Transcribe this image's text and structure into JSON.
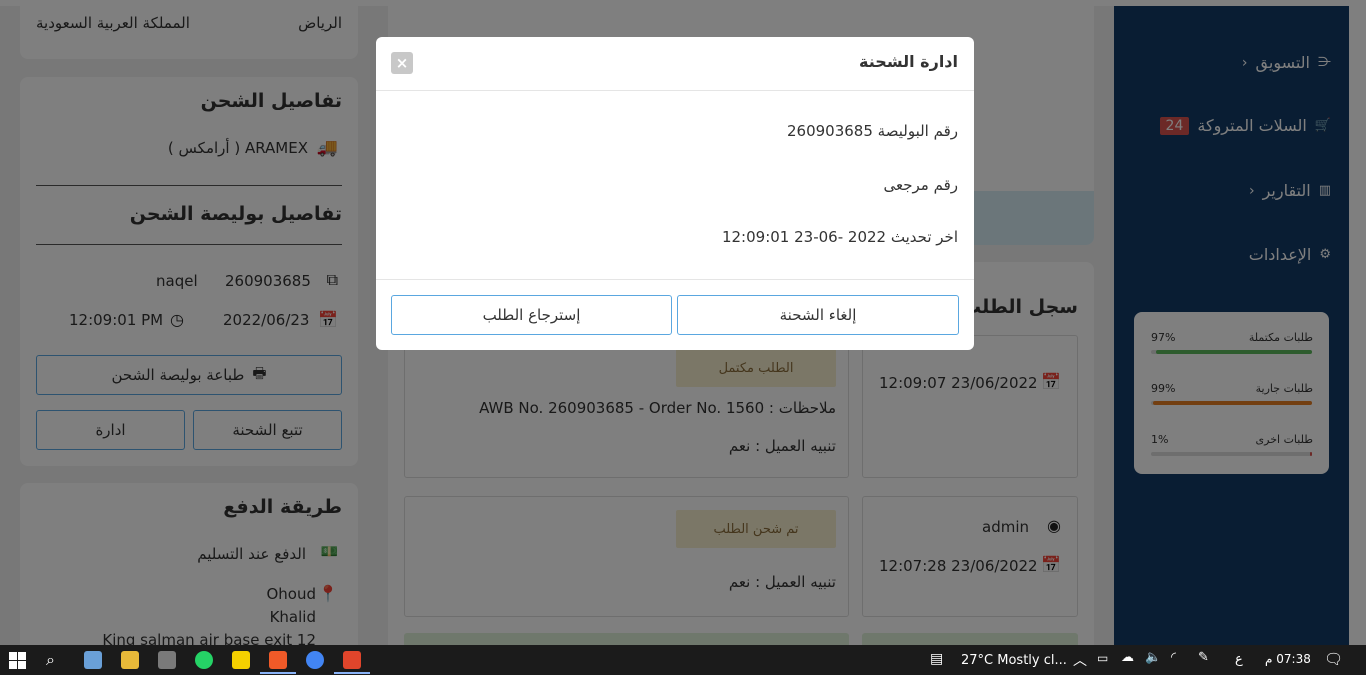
{
  "address": {
    "city": "الرياض",
    "country": "المملكة العربية السعودية"
  },
  "shipping": {
    "title": "تفاصيل الشحن",
    "carrier": "ARAMEX ( أرامكس )",
    "awb_title": "تفاصيل بوليصة الشحن",
    "awb_number": "260903685",
    "awb_company": "naqel",
    "date": "2022/06/23",
    "time": "12:09:01 PM",
    "print_label": "طباعة بوليصة الشحن",
    "track_label": "تتبع الشحنة",
    "manage_label": "ادارة"
  },
  "payment": {
    "title": "طريقة الدفع",
    "method": "الدفع عند التسليم",
    "name_line1": "Ohoud",
    "name_line2": "Khalid",
    "address_line": "King salman air base exit 12"
  },
  "history": {
    "title": "سجل الطلب",
    "entries": [
      {
        "status": "الطلب مكتمل",
        "notes": "ملاحظات : AWB No. 260903685 - Order No. 1560",
        "notify": "تنبيه العميل : نعم",
        "datetime": "12:09:07 23/06/2022"
      },
      {
        "status": "تم شحن الطلب",
        "notify": "تنبيه العميل : نعم",
        "user": "admin",
        "datetime": "12:07:28 23/06/2022"
      }
    ]
  },
  "sidebar": {
    "items": [
      {
        "label": "التسويق",
        "icon": "share-icon"
      },
      {
        "label": "السلات المتروكة",
        "icon": "cart-icon",
        "badge": "24"
      },
      {
        "label": "التقارير",
        "icon": "bar-chart-icon"
      },
      {
        "label": "الإعدادات",
        "icon": "gear-icon"
      }
    ],
    "stats": [
      {
        "label": "طلبات مكتملة",
        "percent": "97%",
        "value": 97,
        "color": "#5cb85c"
      },
      {
        "label": "طلبات جارية",
        "percent": "99%",
        "value": 99,
        "color": "#e67e22"
      },
      {
        "label": "طلبات اخرى",
        "percent": "1%",
        "value": 1,
        "color": "#d9534f"
      }
    ]
  },
  "modal": {
    "title": "ادارة الشحنة",
    "awb_line": "رقم البوليصة 260903685",
    "ref_line": "رقم مرجعى",
    "update_line": "اخر تحديث 2022 -06-23 12:09:01",
    "cancel_label": "إلغاء الشحنة",
    "return_label": "إسترجاع الطلب"
  },
  "taskbar": {
    "weather": "27°C  Mostly cl...",
    "lang": "ع",
    "time": "07:38 م"
  }
}
